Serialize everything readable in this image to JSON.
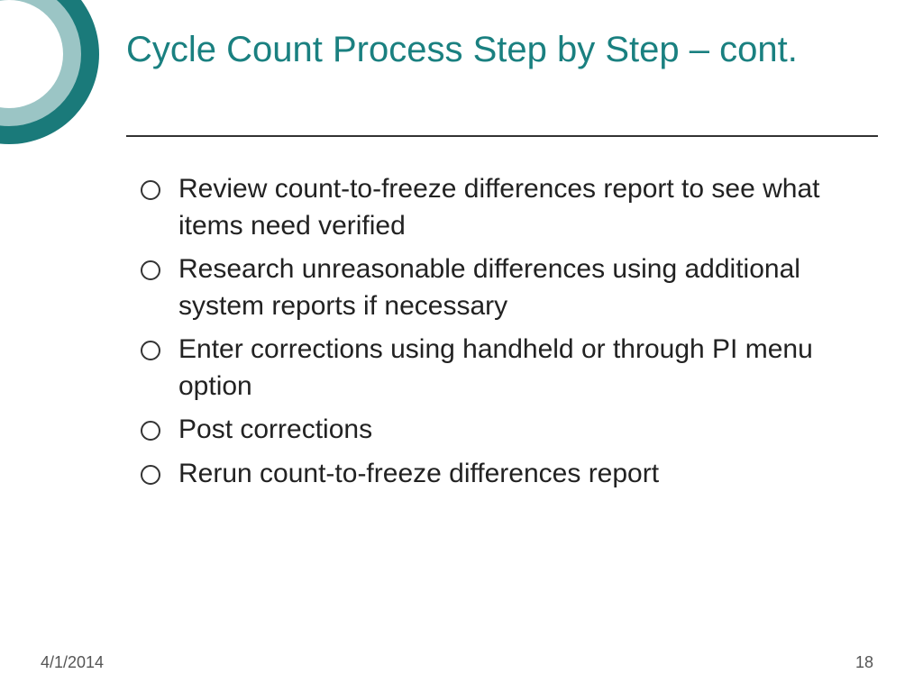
{
  "title": "Cycle Count Process Step by Step – cont.",
  "bullets": [
    "Review count-to-freeze differences report to see what items need verified",
    "Research unreasonable differences using additional system reports if necessary",
    "Enter corrections using handheld or through PI menu option",
    "Post corrections",
    "Rerun count-to-freeze differences report"
  ],
  "footer": {
    "date": "4/1/2014",
    "page": "18"
  }
}
